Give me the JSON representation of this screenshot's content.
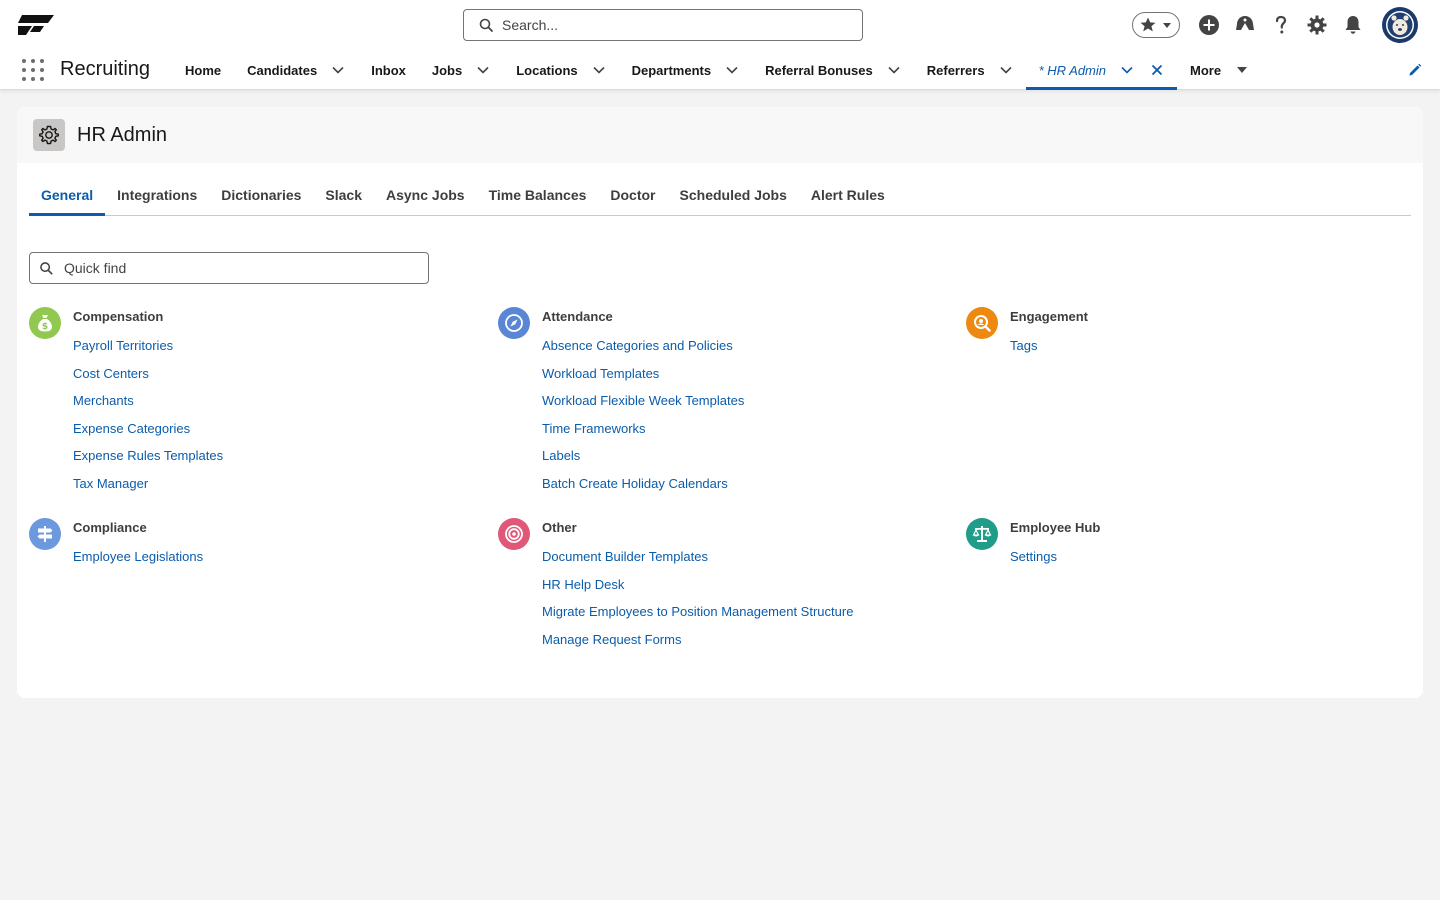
{
  "header": {
    "search_placeholder": "Search...",
    "icons": [
      "favorites-star-icon",
      "add-icon",
      "trailhead-icon",
      "help-icon",
      "setup-gear-icon",
      "notifications-bell-icon",
      "avatar-icon"
    ]
  },
  "app_nav": {
    "app_name": "Recruiting",
    "items": [
      {
        "label": "Home",
        "dropdown": false
      },
      {
        "label": "Candidates",
        "dropdown": true
      },
      {
        "label": "Inbox",
        "dropdown": false
      },
      {
        "label": "Jobs",
        "dropdown": true
      },
      {
        "label": "Locations",
        "dropdown": true
      },
      {
        "label": "Departments",
        "dropdown": true
      },
      {
        "label": "Referral Bonuses",
        "dropdown": true
      },
      {
        "label": "Referrers",
        "dropdown": true
      }
    ],
    "active_tab": "* HR Admin",
    "more_label": "More"
  },
  "page": {
    "title": "HR Admin",
    "tabs": [
      "General",
      "Integrations",
      "Dictionaries",
      "Slack",
      "Async Jobs",
      "Time Balances",
      "Doctor",
      "Scheduled Jobs",
      "Alert Rules"
    ],
    "active_tab": "General",
    "quick_find_placeholder": "Quick find"
  },
  "sections": {
    "compensation": {
      "title": "Compensation",
      "icon": "money-bag-icon",
      "color": "#91c84f",
      "links": [
        "Payroll Territories",
        "Cost Centers",
        "Merchants",
        "Expense Categories",
        "Expense Rules Templates",
        "Tax Manager"
      ]
    },
    "attendance": {
      "title": "Attendance",
      "icon": "compass-icon",
      "color": "#5a86d6",
      "links": [
        "Absence Categories and Policies",
        "Workload Templates",
        "Workload Flexible Week Templates",
        "Time Frameworks",
        "Labels",
        "Batch Create Holiday Calendars"
      ]
    },
    "engagement": {
      "title": "Engagement",
      "icon": "engagement-search-icon",
      "color": "#ed8810",
      "links": [
        "Tags"
      ]
    },
    "compliance": {
      "title": "Compliance",
      "icon": "signpost-icon",
      "color": "#6c98de",
      "links": [
        "Employee Legislations"
      ]
    },
    "other": {
      "title": "Other",
      "icon": "target-icon",
      "color": "#e05878",
      "links": [
        "Document Builder Templates",
        "HR Help Desk",
        "Migrate Employees to Position Management Structure",
        "Manage Request Forms"
      ]
    },
    "employee_hub": {
      "title": "Employee Hub",
      "icon": "scales-icon",
      "color": "#1f9c8a",
      "links": [
        "Settings"
      ]
    }
  }
}
